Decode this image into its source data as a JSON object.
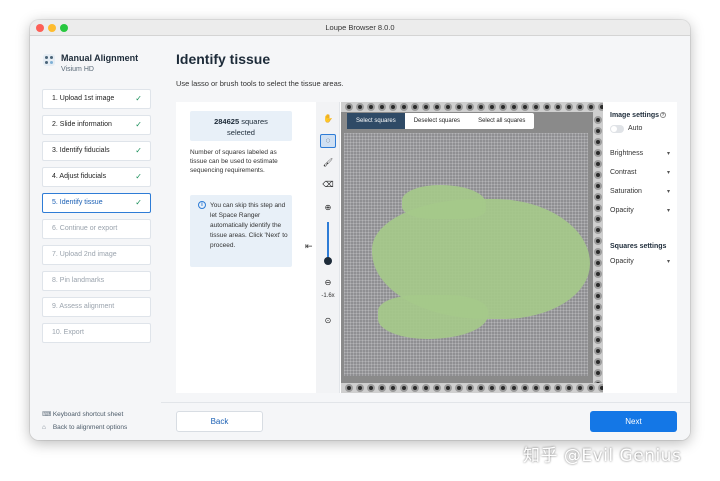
{
  "window": {
    "title": "Loupe Browser 8.0.0"
  },
  "sidebar": {
    "app_title": "Manual Alignment",
    "app_subtitle": "Visium HD",
    "steps": [
      {
        "label": "1. Upload 1st image",
        "state": "done"
      },
      {
        "label": "2. Slide information",
        "state": "done"
      },
      {
        "label": "3. Identify fiducials",
        "state": "done"
      },
      {
        "label": "4. Adjust fiducials",
        "state": "done"
      },
      {
        "label": "5. Identify tissue",
        "state": "active"
      },
      {
        "label": "6. Continue or export",
        "state": "disabled"
      },
      {
        "label": "7. Upload 2nd image",
        "state": "disabled"
      },
      {
        "label": "8. Pin landmarks",
        "state": "disabled"
      },
      {
        "label": "9. Assess alignment",
        "state": "disabled"
      },
      {
        "label": "10. Export",
        "state": "disabled"
      }
    ],
    "keyboard_shortcut": "Keyboard shortcut sheet",
    "back_to_options": "Back to alignment options"
  },
  "main": {
    "title": "Identify tissue",
    "subtitle": "Use lasso or brush tools to select the tissue areas.",
    "count_value": "284625",
    "count_unit": "squares",
    "count_label": "selected",
    "info_text": "Number of squares labeled as tissue can be used to estimate sequencing requirements.",
    "note_text": "You can skip this step and let Space Ranger automatically identify the tissue areas. Click 'Next' to proceed.",
    "zoom_level": "-1.6x"
  },
  "viewer": {
    "tabs": [
      "Select squares",
      "Deselect squares",
      "Select all squares"
    ],
    "active_tab": "Select squares"
  },
  "settings": {
    "image_header": "Image settings",
    "auto_label": "Auto",
    "auto_on": false,
    "image_items": [
      "Brightness",
      "Contrast",
      "Saturation",
      "Opacity"
    ],
    "squares_header": "Squares settings",
    "squares_items": [
      "Opacity"
    ]
  },
  "footer": {
    "back_label": "Back",
    "next_label": "Next"
  },
  "watermark": "知乎 @Evil Genius",
  "colors": {
    "accent": "#1477e6",
    "tissue_overlay": "#a5c98a",
    "active_tab": "#2f4a66",
    "check": "#1a8f5a"
  },
  "icons": {
    "tools": [
      "hand-icon",
      "lasso-icon",
      "brush-icon",
      "eraser-icon",
      "zoom-in-icon",
      "zoom-out-icon",
      "recenter-icon"
    ]
  }
}
